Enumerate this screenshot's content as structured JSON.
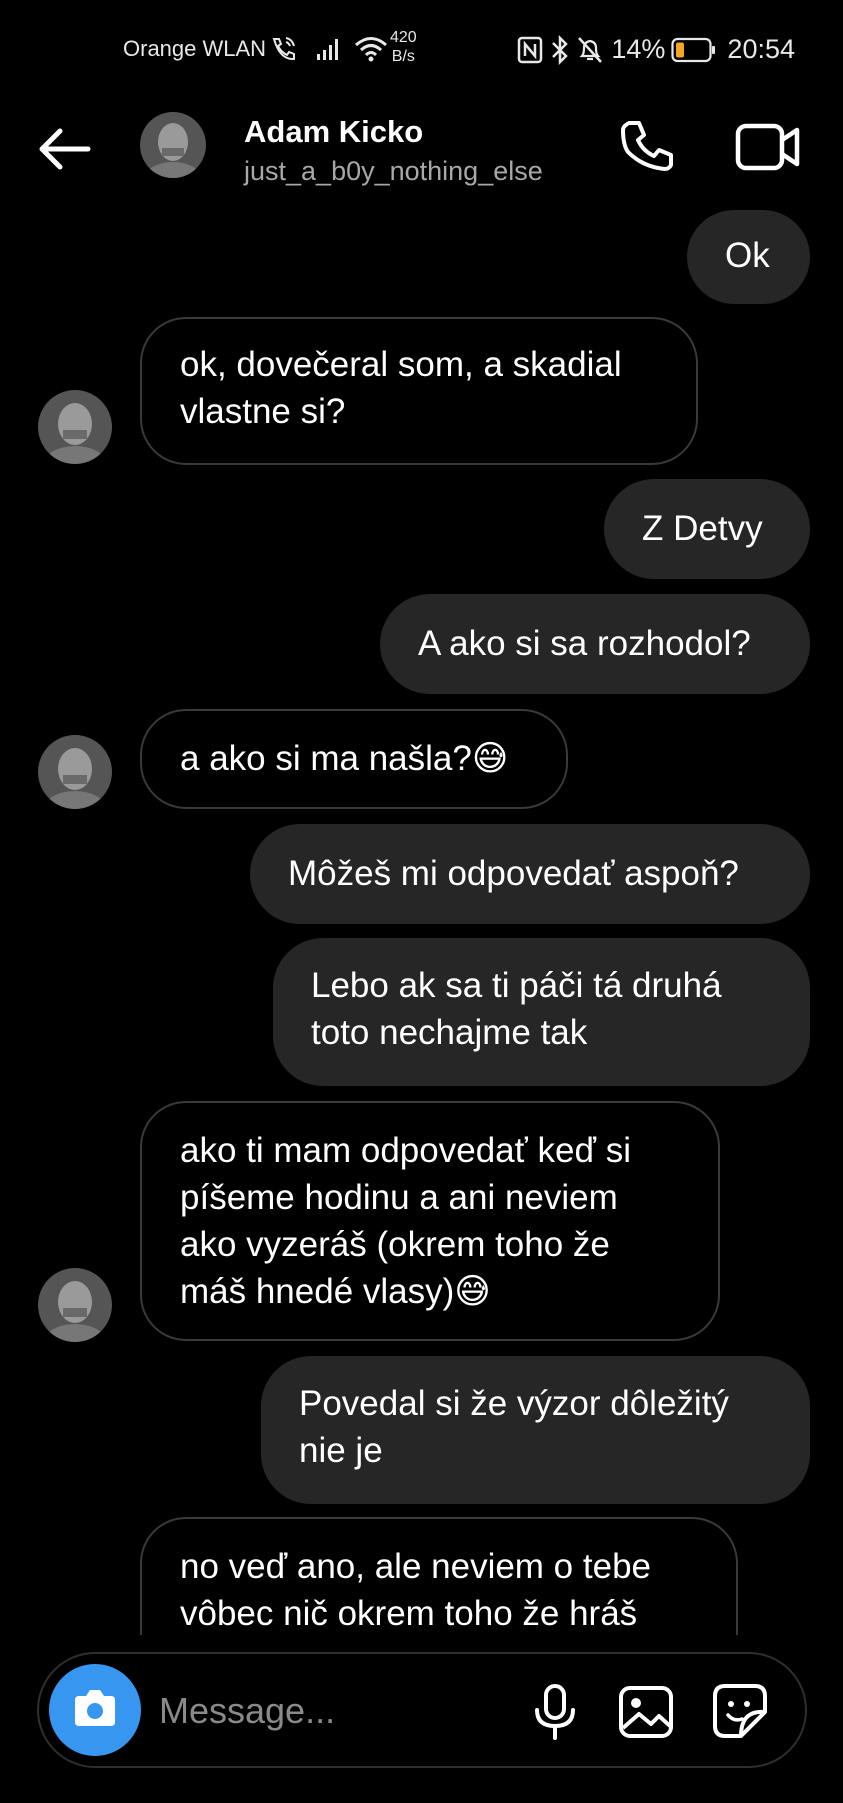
{
  "status_bar": {
    "carrier": "Orange WLAN",
    "speed_value": "420",
    "speed_unit": "B/s",
    "battery": "14%",
    "time": "20:54"
  },
  "header": {
    "name": "Adam Kicko",
    "username": "just_a_b0y_nothing_else"
  },
  "messages": [
    {
      "direction": "out",
      "lines": [
        "Ok"
      ]
    },
    {
      "direction": "in",
      "lines": [
        "ok, dovečeral som, a skadial",
        "vlastne si?"
      ]
    },
    {
      "direction": "out",
      "lines": [
        "Z Detvy"
      ]
    },
    {
      "direction": "out",
      "lines": [
        "A ako si sa rozhodol?"
      ]
    },
    {
      "direction": "in",
      "lines": [
        "a ako si ma našla?😅"
      ]
    },
    {
      "direction": "out",
      "lines": [
        "Môžeš mi odpovedať aspoň?"
      ]
    },
    {
      "direction": "out",
      "lines": [
        "Lebo ak sa ti páči tá druhá",
        "toto nechajme tak"
      ]
    },
    {
      "direction": "in",
      "lines": [
        "ako ti mam odpovedať keď si",
        "píšeme hodinu a ani neviem",
        "ako vyzeráš (okrem toho že",
        "máš hnedé vlasy)😅"
      ]
    },
    {
      "direction": "out",
      "lines": [
        "Povedal si že výzor dôležitý",
        "nie je"
      ]
    },
    {
      "direction": "in",
      "lines": [
        "no veď ano, ale neviem o tebe",
        "vôbec nič okrem toho že hráš"
      ]
    }
  ],
  "composer": {
    "placeholder": "Message..."
  },
  "colors": {
    "background": "#000000",
    "outgoing_bubble": "#262626",
    "incoming_border": "#3a3a3a",
    "camera_button": "#3797f0",
    "battery_low": "#f5a623"
  },
  "icons": [
    "call-icon",
    "no-data-icon",
    "wifi-icon",
    "nfc-icon",
    "bluetooth-icon",
    "mute-icon",
    "battery-icon",
    "back-arrow-icon",
    "phone-icon",
    "video-icon",
    "camera-icon",
    "microphone-icon",
    "gallery-icon",
    "sticker-icon"
  ]
}
